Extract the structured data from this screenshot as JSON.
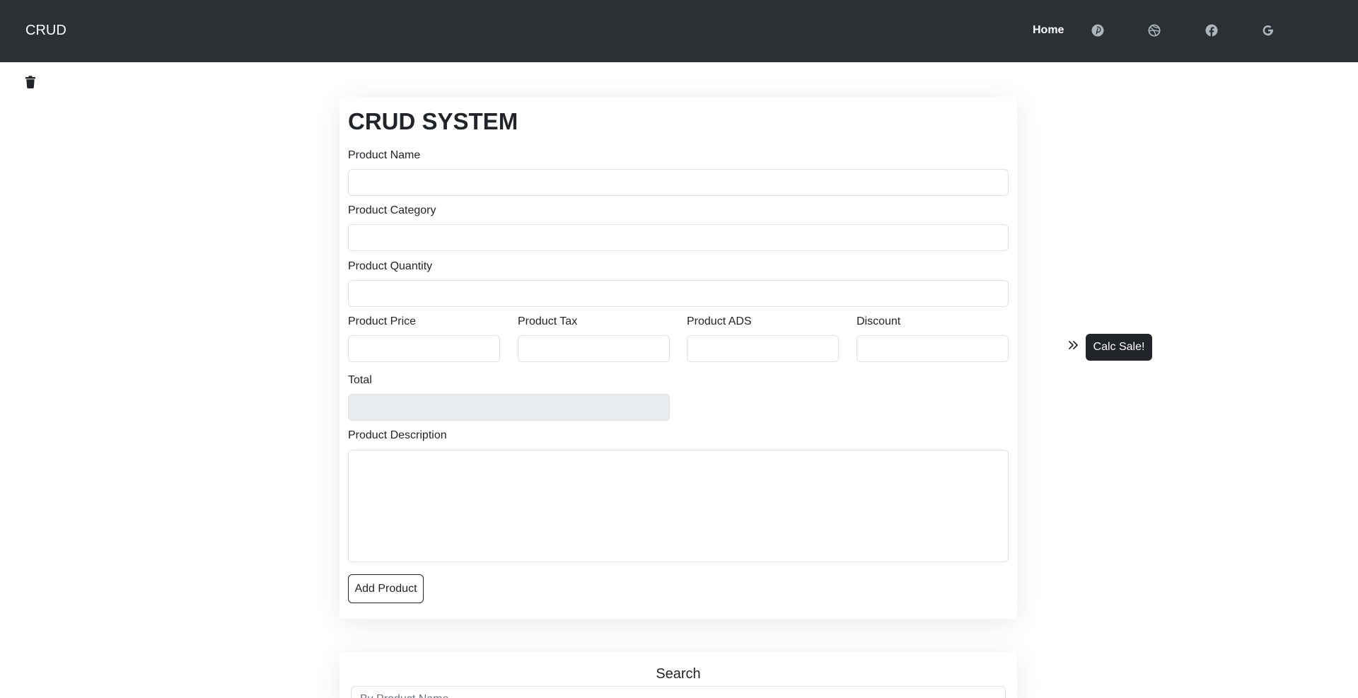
{
  "navbar": {
    "brand": "CRUD",
    "home": "Home",
    "icons": [
      "pinterest-icon",
      "dribbble-icon",
      "facebook-icon",
      "google-icon"
    ]
  },
  "toolbar": {
    "trash_icon": "trash-icon"
  },
  "form": {
    "title": "CRUD SYSTEM",
    "product_name_label": "Product Name",
    "product_name_value": "",
    "product_category_label": "Product Category",
    "product_category_value": "",
    "product_quantity_label": "Product Quantity",
    "product_quantity_value": "",
    "product_price_label": "Product Price",
    "product_price_value": "",
    "product_tax_label": "Product Tax",
    "product_tax_value": "",
    "product_ads_label": "Product ADS",
    "product_ads_value": "",
    "discount_label": "Discount",
    "discount_value": "",
    "total_label": "Total",
    "total_value": "",
    "description_label": "Product Description",
    "description_value": "",
    "add_button": "Add Product"
  },
  "side": {
    "chevron_icon": "double-chevron-right-icon",
    "calc_button": "Calc Sale!"
  },
  "search": {
    "title": "Search",
    "placeholder": "By Product Name"
  },
  "colors": {
    "navbar_bg": "#2b3035",
    "dark_button": "#212529",
    "disabled_input": "#e9ecef"
  }
}
